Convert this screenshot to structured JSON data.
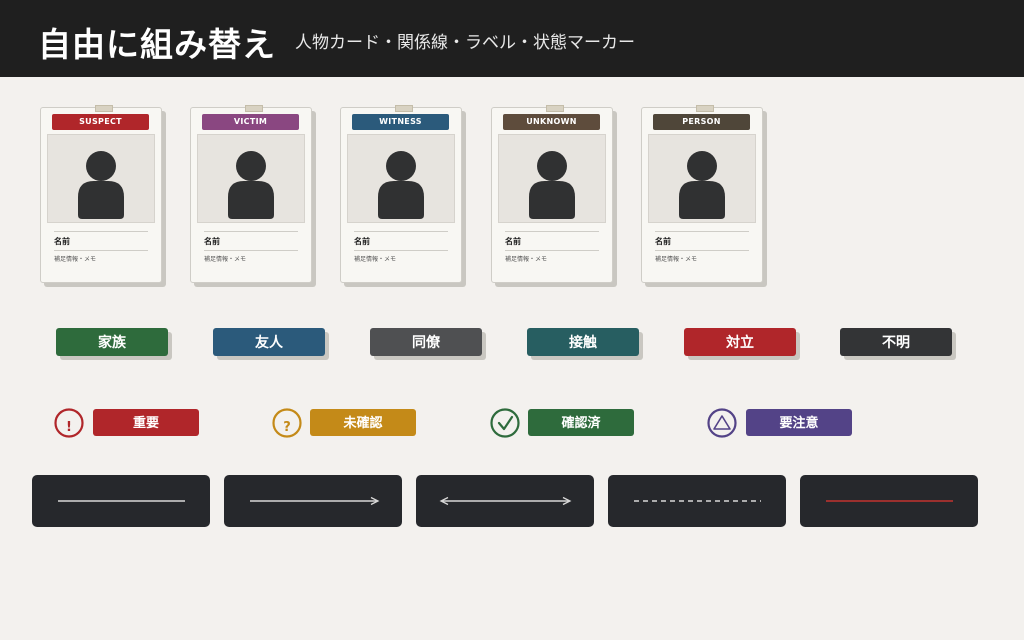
{
  "header": {
    "title": "自由に組み替え",
    "subtitle": "人物カード・関係線・ラベル・状態マーカー"
  },
  "cards": [
    {
      "role": "SUSPECT",
      "color": "#b0262a",
      "name": "名前",
      "memo": "補足情報・メモ"
    },
    {
      "role": "VICTIM",
      "color": "#8a4781",
      "name": "名前",
      "memo": "補足情報・メモ"
    },
    {
      "role": "WITNESS",
      "color": "#2b5a7b",
      "name": "名前",
      "memo": "補足情報・メモ"
    },
    {
      "role": "UNKNOWN",
      "color": "#5e4c3c",
      "name": "名前",
      "memo": "補足情報・メモ"
    },
    {
      "role": "PERSON",
      "color": "#4f4639",
      "name": "名前",
      "memo": "補足情報・メモ"
    }
  ],
  "relation_labels": [
    {
      "label": "家族",
      "color": "#2e6b3c"
    },
    {
      "label": "友人",
      "color": "#2b5a7b"
    },
    {
      "label": "同僚",
      "color": "#4f5052"
    },
    {
      "label": "接触",
      "color": "#275e61"
    },
    {
      "label": "対立",
      "color": "#b0262a"
    },
    {
      "label": "不明",
      "color": "#333436"
    }
  ],
  "status_markers": [
    {
      "label": "重要",
      "symbol": "!",
      "icon": "exclamation-circle-icon",
      "color": "#b0262a"
    },
    {
      "label": "未確認",
      "symbol": "?",
      "icon": "question-circle-icon",
      "color": "#c48a18"
    },
    {
      "label": "確認済",
      "symbol": "✓",
      "icon": "check-circle-icon",
      "color": "#2e6b3c"
    },
    {
      "label": "要注意",
      "symbol": "△",
      "icon": "triangle-circle-icon",
      "color": "#534387"
    }
  ],
  "line_styles": [
    {
      "style": "solid",
      "arrows": "none",
      "color": "#d8d8d8"
    },
    {
      "style": "solid",
      "arrows": "end",
      "color": "#d8d8d8"
    },
    {
      "style": "solid",
      "arrows": "both",
      "color": "#d8d8d8"
    },
    {
      "style": "dashed",
      "arrows": "none",
      "color": "#d8d8d8"
    },
    {
      "style": "solid",
      "arrows": "none",
      "color": "#c2332e"
    }
  ]
}
